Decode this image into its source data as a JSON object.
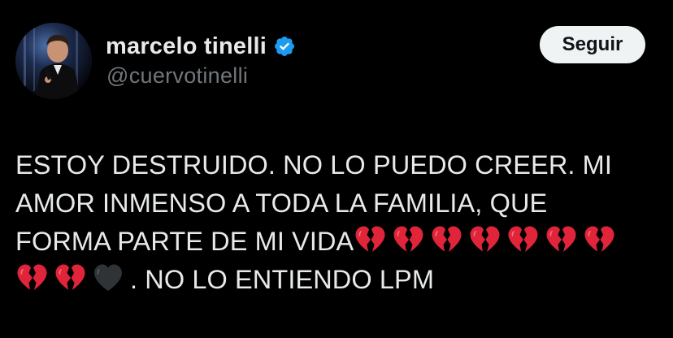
{
  "tweet": {
    "author": {
      "display_name": "marcelo tinelli",
      "handle": "@cuervotinelli",
      "verified": true
    },
    "follow_button_label": "Seguir",
    "text_lines": [
      "ESTOY DESTRUIDO. NO LO PUEDO CREER. MI",
      "AMOR INMENSO A TODA LA FAMILIA, QUE",
      "FORMA PARTE DE MI VIDA",
      ". NO LO ENTIENDO LPM"
    ],
    "emojis_line3": [
      "broken-heart",
      "broken-heart",
      "broken-heart",
      "broken-heart",
      "broken-heart",
      "broken-heart",
      "broken-heart"
    ],
    "emojis_line4": [
      "broken-heart",
      "broken-heart",
      "black-heart"
    ]
  },
  "colors": {
    "background": "#000000",
    "text_primary": "#e7e9ea",
    "text_secondary": "#71767b",
    "verified_badge": "#1d9bf0",
    "button_bg": "#eff3f4",
    "button_text": "#0f1419",
    "broken_heart": "#e0243a",
    "black_heart": "#2f3336"
  }
}
